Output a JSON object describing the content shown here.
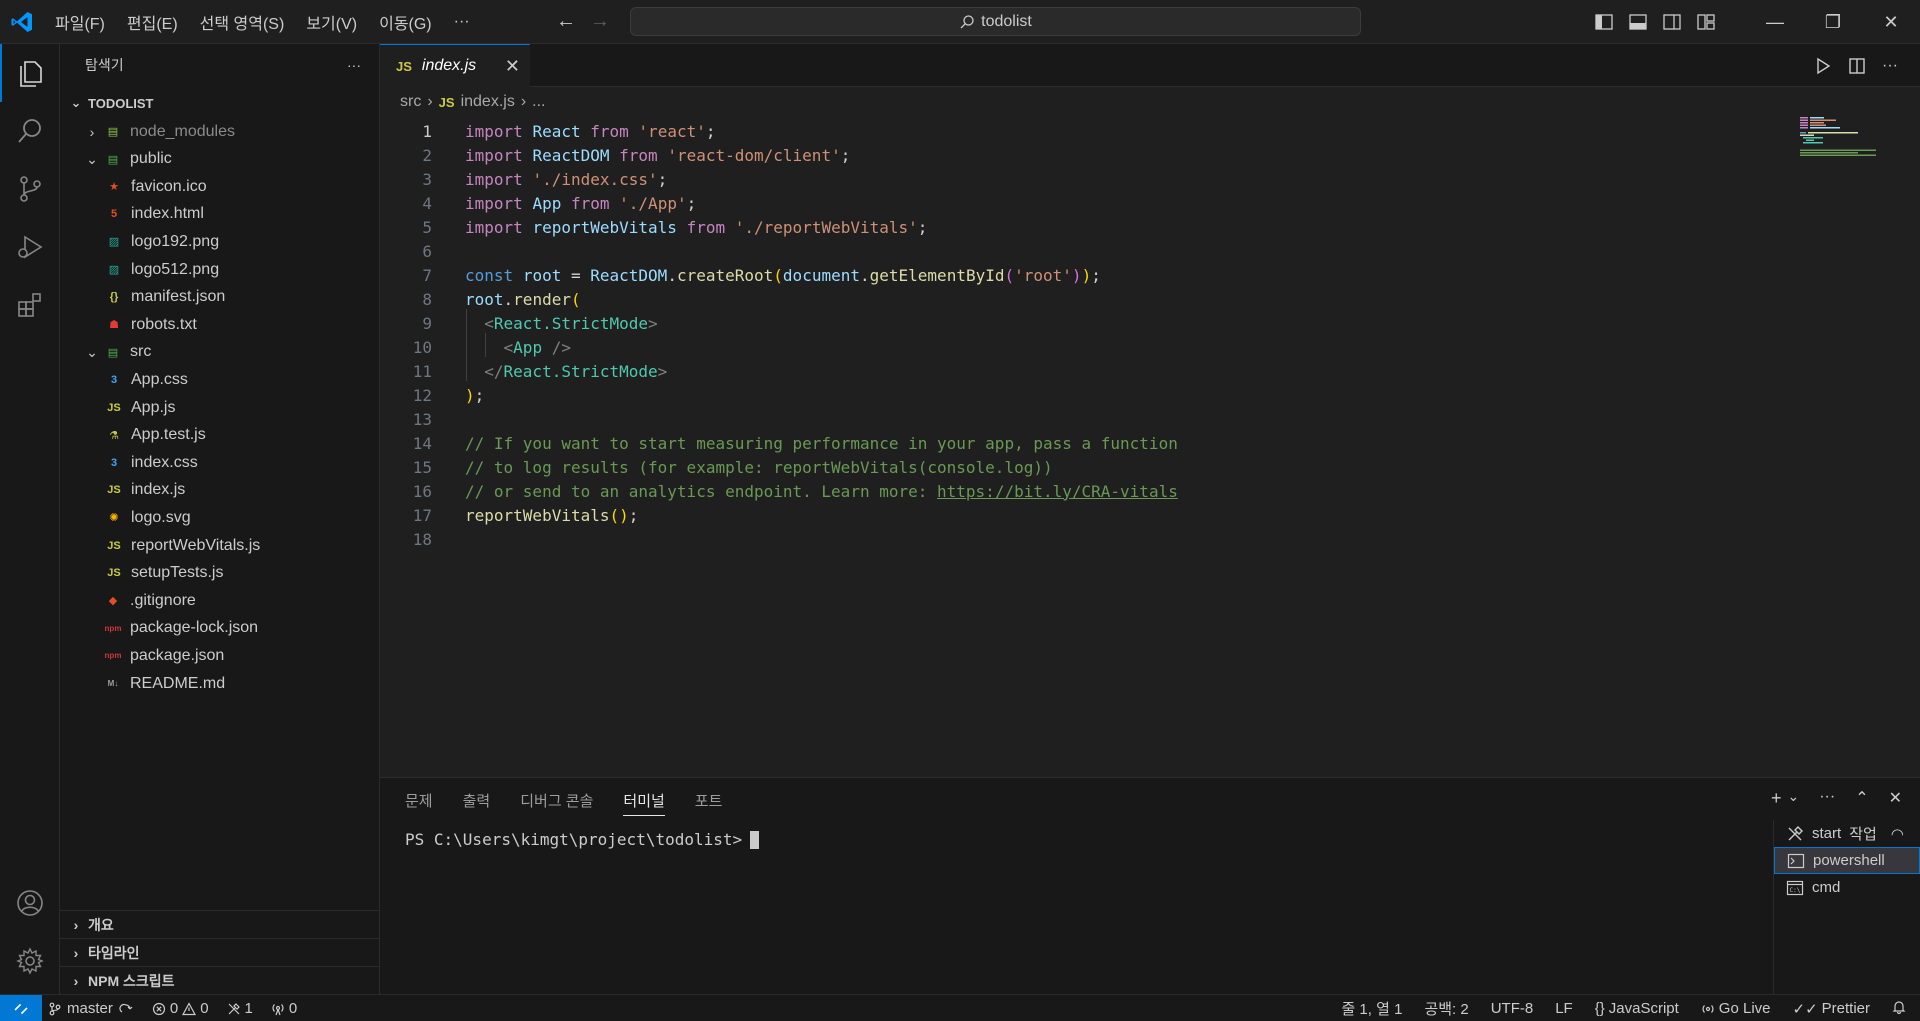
{
  "titlebar": {
    "menu": [
      "파일(F)",
      "편집(E)",
      "선택 영역(S)",
      "보기(V)",
      "이동(G)",
      "···"
    ],
    "search_text": "todolist",
    "win_minimize": "—",
    "win_restore": "❐",
    "win_close": "✕"
  },
  "sidebar": {
    "title": "탐색기",
    "more": "···",
    "folder": "TODOLIST",
    "tree": [
      {
        "label": "node_modules",
        "chev": "›",
        "icon": "folder-node-icon",
        "indent": 1
      },
      {
        "label": "public",
        "chev": "⌄",
        "icon": "folder-public-icon",
        "indent": 1
      },
      {
        "label": "favicon.ico",
        "icon": "favicon-icon",
        "indent": 2
      },
      {
        "label": "index.html",
        "icon": "html-icon",
        "indent": 2
      },
      {
        "label": "logo192.png",
        "icon": "image-icon",
        "indent": 2
      },
      {
        "label": "logo512.png",
        "icon": "image-icon",
        "indent": 2
      },
      {
        "label": "manifest.json",
        "icon": "json-braces-icon",
        "indent": 2
      },
      {
        "label": "robots.txt",
        "icon": "robot-icon",
        "indent": 2
      },
      {
        "label": "src",
        "chev": "⌄",
        "icon": "folder-src-icon",
        "indent": 1
      },
      {
        "label": "App.css",
        "icon": "css-icon",
        "indent": 2
      },
      {
        "label": "App.js",
        "icon": "js-icon",
        "indent": 2
      },
      {
        "label": "App.test.js",
        "icon": "test-icon",
        "indent": 2
      },
      {
        "label": "index.css",
        "icon": "css-icon",
        "indent": 2
      },
      {
        "label": "index.js",
        "icon": "js-icon",
        "indent": 2
      },
      {
        "label": "logo.svg",
        "icon": "svg-icon",
        "indent": 2
      },
      {
        "label": "reportWebVitals.js",
        "icon": "js-icon",
        "indent": 2
      },
      {
        "label": "setupTests.js",
        "icon": "js-icon",
        "indent": 2
      },
      {
        "label": ".gitignore",
        "icon": "git-icon",
        "indent": 1
      },
      {
        "label": "package-lock.json",
        "icon": "npm-icon",
        "indent": 1
      },
      {
        "label": "package.json",
        "icon": "npm-icon",
        "indent": 1
      },
      {
        "label": "README.md",
        "icon": "markdown-icon",
        "indent": 1
      }
    ],
    "sections": [
      "개요",
      "타임라인",
      "NPM 스크립트"
    ]
  },
  "editor": {
    "tab_label": "index.js",
    "tab_badge": "JS",
    "breadcrumb": {
      "folder": "src",
      "badge": "JS",
      "file": "index.js",
      "rest": "..."
    },
    "line_numbers": [
      "1",
      "2",
      "3",
      "4",
      "5",
      "6",
      "7",
      "8",
      "9",
      "10",
      "11",
      "12",
      "13",
      "14",
      "15",
      "16",
      "17",
      "18"
    ],
    "code": [
      [
        [
          "kw",
          "import"
        ],
        [
          "plain",
          " "
        ],
        [
          "var",
          "React"
        ],
        [
          "plain",
          " "
        ],
        [
          "kw",
          "from"
        ],
        [
          "plain",
          " "
        ],
        [
          "str",
          "'react'"
        ],
        [
          "plain",
          ";"
        ]
      ],
      [
        [
          "kw",
          "import"
        ],
        [
          "plain",
          " "
        ],
        [
          "var",
          "ReactDOM"
        ],
        [
          "plain",
          " "
        ],
        [
          "kw",
          "from"
        ],
        [
          "plain",
          " "
        ],
        [
          "str",
          "'react-dom/client'"
        ],
        [
          "plain",
          ";"
        ]
      ],
      [
        [
          "kw",
          "import"
        ],
        [
          "plain",
          " "
        ],
        [
          "str",
          "'./index.css'"
        ],
        [
          "plain",
          ";"
        ]
      ],
      [
        [
          "kw",
          "import"
        ],
        [
          "plain",
          " "
        ],
        [
          "var",
          "App"
        ],
        [
          "plain",
          " "
        ],
        [
          "kw",
          "from"
        ],
        [
          "plain",
          " "
        ],
        [
          "str",
          "'./App'"
        ],
        [
          "plain",
          ";"
        ]
      ],
      [
        [
          "kw",
          "import"
        ],
        [
          "plain",
          " "
        ],
        [
          "var",
          "reportWebVitals"
        ],
        [
          "plain",
          " "
        ],
        [
          "kw",
          "from"
        ],
        [
          "plain",
          " "
        ],
        [
          "str",
          "'./reportWebVitals'"
        ],
        [
          "plain",
          ";"
        ]
      ],
      [],
      [
        [
          "kb",
          "const"
        ],
        [
          "plain",
          " "
        ],
        [
          "var",
          "root"
        ],
        [
          "plain",
          " = "
        ],
        [
          "var",
          "ReactDOM"
        ],
        [
          "plain",
          "."
        ],
        [
          "fn",
          "createRoot"
        ],
        [
          "br1",
          "("
        ],
        [
          "var",
          "document"
        ],
        [
          "plain",
          "."
        ],
        [
          "fn",
          "getElementById"
        ],
        [
          "br2",
          "("
        ],
        [
          "str",
          "'root'"
        ],
        [
          "br2",
          ")"
        ],
        [
          "br1",
          ")"
        ],
        [
          "plain",
          ";"
        ]
      ],
      [
        [
          "var",
          "root"
        ],
        [
          "plain",
          "."
        ],
        [
          "fn",
          "render"
        ],
        [
          "br1",
          "("
        ]
      ],
      [
        [
          "plain",
          "  "
        ],
        [
          "punc",
          "<"
        ],
        [
          "tag",
          "React.StrictMode"
        ],
        [
          "punc",
          ">"
        ]
      ],
      [
        [
          "plain",
          "    "
        ],
        [
          "punc",
          "<"
        ],
        [
          "tag",
          "App"
        ],
        [
          "plain",
          " "
        ],
        [
          "punc",
          "/>"
        ]
      ],
      [
        [
          "plain",
          "  "
        ],
        [
          "punc",
          "</"
        ],
        [
          "tag",
          "React.StrictMode"
        ],
        [
          "punc",
          ">"
        ]
      ],
      [
        [
          "br1",
          ")"
        ],
        [
          "plain",
          ";"
        ]
      ],
      [],
      [
        [
          "cmt",
          "// If you want to start measuring performance in your app, pass a function"
        ]
      ],
      [
        [
          "cmt",
          "// to log results (for example: reportWebVitals(console.log))"
        ]
      ],
      [
        [
          "cmt",
          "// or send to an analytics endpoint. Learn more: "
        ],
        [
          "link",
          "https://bit.ly/CRA-vitals"
        ]
      ],
      [
        [
          "fn",
          "reportWebVitals"
        ],
        [
          "br1",
          "()"
        ],
        [
          "plain",
          ";"
        ]
      ],
      []
    ]
  },
  "panel": {
    "tabs": [
      "문제",
      "출력",
      "디버그 콘솔",
      "터미널",
      "포트"
    ],
    "active_tab": "터미널",
    "prompt": "PS C:\\Users\\kimgt\\project\\todolist>",
    "terminals": [
      {
        "label": "start",
        "suffix": "작업"
      },
      {
        "label": "powershell"
      },
      {
        "label": "cmd"
      }
    ]
  },
  "statusbar": {
    "branch": "master",
    "errors": "0",
    "warnings": "0",
    "ports": "1",
    "radio": "0",
    "position": "줄 1, 열 1",
    "spaces": "공백: 2",
    "encoding": "UTF-8",
    "eol": "LF",
    "language": "JavaScript",
    "golive": "Go Live",
    "prettier": "Prettier"
  },
  "colors": {
    "accent": "#0078d4",
    "background": "#1f1f1f",
    "sidebar": "#181818",
    "js_badge": "#cbcb41"
  }
}
